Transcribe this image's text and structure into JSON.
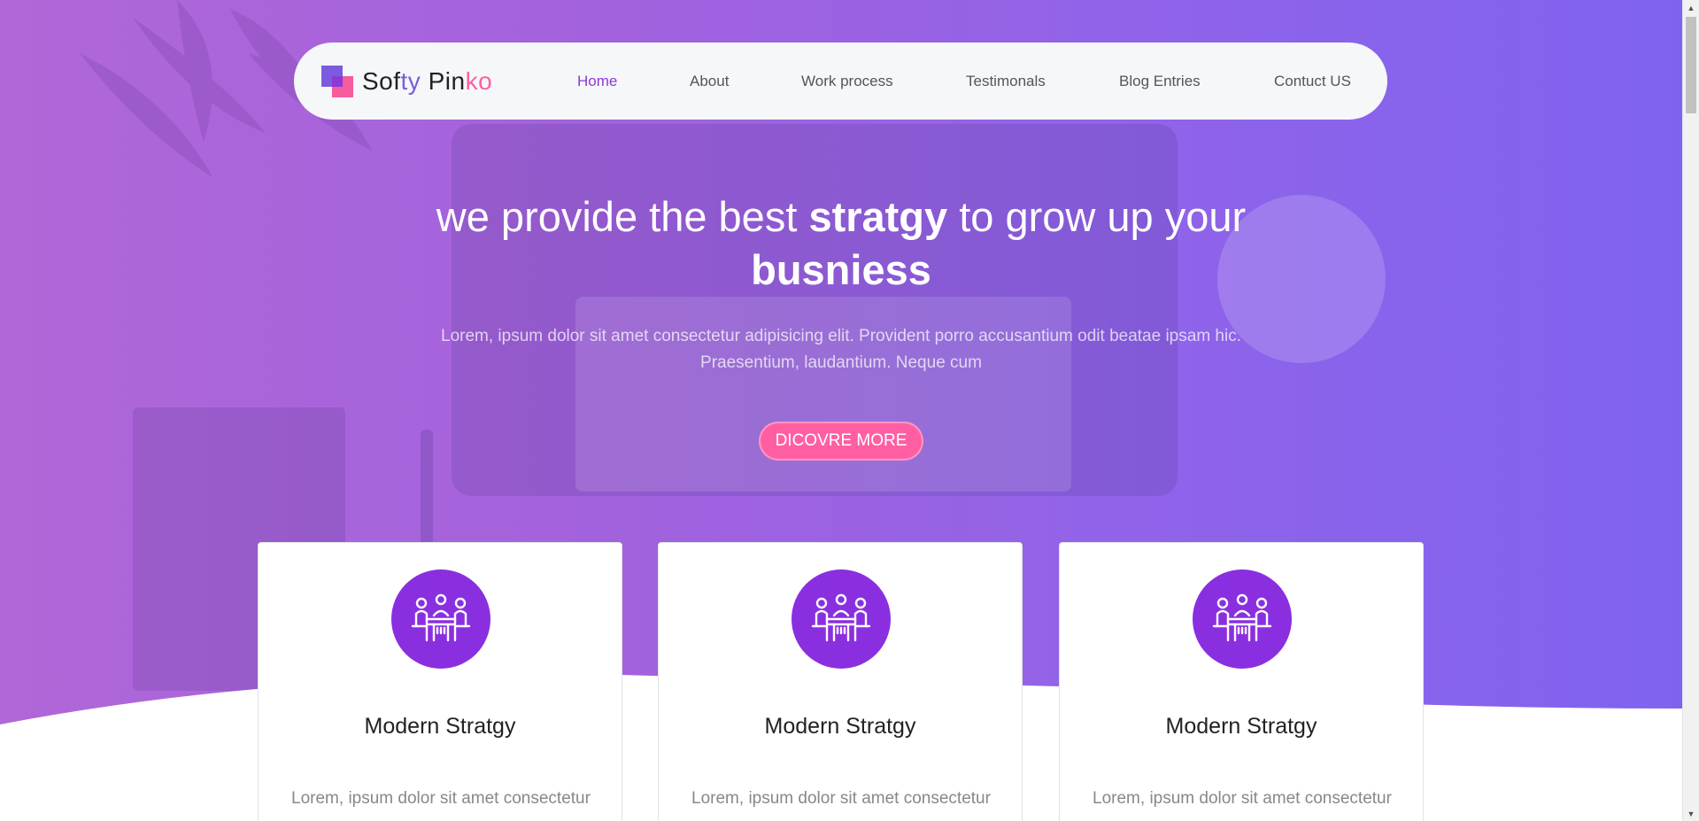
{
  "brand": {
    "name_part1": "Sof",
    "name_part2": "ty",
    "name_part3": " Pin",
    "name_part4": "ko",
    "colors": {
      "purple": "#7b5ce0",
      "pink": "#ff5fa2",
      "accent": "#8a3bd6"
    }
  },
  "nav": {
    "items": [
      {
        "label": "Home",
        "active": true
      },
      {
        "label": "About",
        "active": false
      },
      {
        "label": "Work process",
        "active": false
      },
      {
        "label": "Testimonals",
        "active": false
      },
      {
        "label": "Blog Entries",
        "active": false
      },
      {
        "label": "Contuct US",
        "active": false
      }
    ]
  },
  "hero": {
    "headline_part1": "we provide the best ",
    "headline_bold1": "stratgy",
    "headline_part2": " to grow up your",
    "headline_bold2": "busniess",
    "subtext_line1": "Lorem, ipsum dolor sit amet consectetur adipisicing elit. Provident porro accusantium odit beatae ipsam hic.",
    "subtext_line2": "Praesentium, laudantium. Neque cum",
    "cta_label": "DICOVRE MORE"
  },
  "cards": [
    {
      "icon": "meeting-icon",
      "title": "Modern Stratgy",
      "text": "Lorem, ipsum dolor sit amet consectetur"
    },
    {
      "icon": "meeting-icon",
      "title": "Modern Stratgy",
      "text": "Lorem, ipsum dolor sit amet consectetur"
    },
    {
      "icon": "meeting-icon",
      "title": "Modern Stratgy",
      "text": "Lorem, ipsum dolor sit amet consectetur"
    }
  ]
}
